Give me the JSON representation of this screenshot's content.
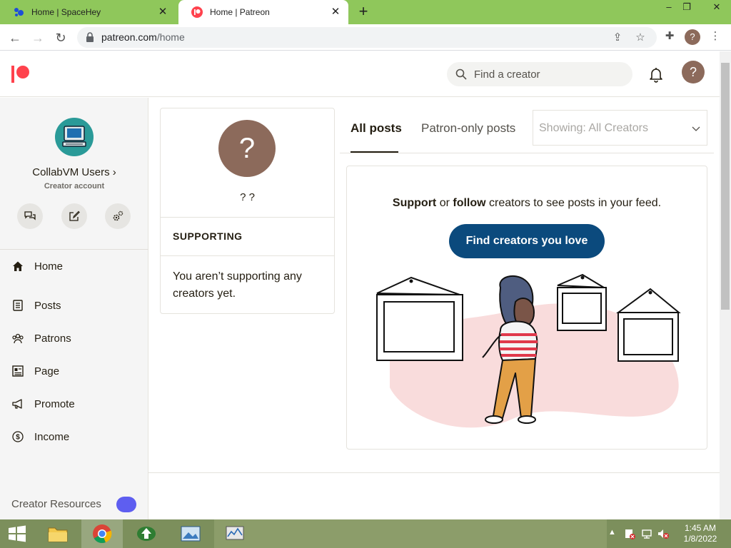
{
  "browser": {
    "tabs": [
      {
        "title": "Home | SpaceHey",
        "active": false
      },
      {
        "title": "Home | Patreon",
        "active": true
      }
    ],
    "new_tab_symbol": "+",
    "close_symbol": "✕",
    "window_controls": {
      "minimize": "–",
      "maximize": "❐",
      "close": "✕"
    },
    "url_host": "patreon.com",
    "url_path": "/home",
    "profile_initial": "?"
  },
  "header": {
    "search_placeholder": "Find a creator",
    "avatar_initial": "?"
  },
  "sidebar": {
    "account_name": "CollabVM Users ›",
    "account_role": "Creator account",
    "nav": [
      {
        "label": "Home",
        "icon": "home-icon"
      },
      {
        "label": "Posts",
        "icon": "posts-icon"
      },
      {
        "label": "Patrons",
        "icon": "patrons-icon"
      },
      {
        "label": "Page",
        "icon": "page-icon"
      },
      {
        "label": "Promote",
        "icon": "megaphone-icon"
      },
      {
        "label": "Income",
        "icon": "dollar-icon"
      }
    ],
    "resources_label": "Creator Resources"
  },
  "profile": {
    "avatar_initial": "?",
    "name": "? ?",
    "section_heading": "SUPPORTING",
    "empty_message": "You aren’t supporting any creators yet."
  },
  "feed": {
    "tabs": [
      {
        "label": "All posts",
        "active": true
      },
      {
        "label": "Patron-only posts",
        "active": false
      }
    ],
    "filter_label": "Showing: All Creators",
    "message_bold_1": "Support",
    "message_mid": " or ",
    "message_bold_2": "follow",
    "message_rest": " creators to see posts in your feed.",
    "cta_label": "Find creators you love"
  },
  "taskbar": {
    "time": "1:45 AM",
    "date": "1/8/2022"
  },
  "colors": {
    "tab_strip": "#8fc75b",
    "patreon_red": "#ff424d",
    "cta": "#0b4a7d",
    "avatar": "#8c6a5b"
  }
}
